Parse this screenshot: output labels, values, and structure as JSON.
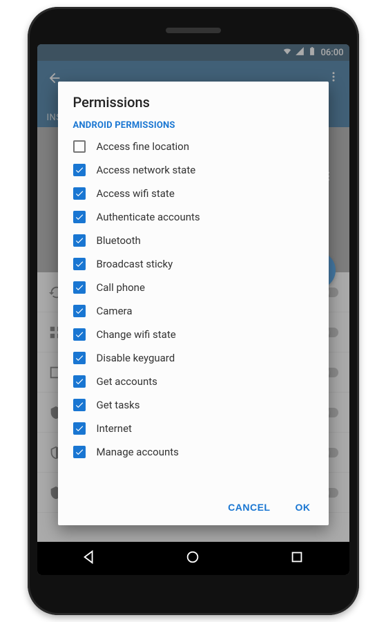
{
  "status": {
    "time": "06:00"
  },
  "appbar": {
    "tab": "INSTA"
  },
  "dialog": {
    "title": "Permissions",
    "section": "ANDROID PERMISSIONS",
    "items": [
      {
        "label": "Access fine location",
        "checked": false
      },
      {
        "label": "Access network state",
        "checked": true
      },
      {
        "label": "Access wifi state",
        "checked": true
      },
      {
        "label": "Authenticate accounts",
        "checked": true
      },
      {
        "label": "Bluetooth",
        "checked": true
      },
      {
        "label": "Broadcast sticky",
        "checked": true
      },
      {
        "label": "Call phone",
        "checked": true
      },
      {
        "label": "Camera",
        "checked": true
      },
      {
        "label": "Change wifi state",
        "checked": true
      },
      {
        "label": "Disable keyguard",
        "checked": true
      },
      {
        "label": "Get accounts",
        "checked": true
      },
      {
        "label": "Get tasks",
        "checked": true
      },
      {
        "label": "Internet",
        "checked": true
      },
      {
        "label": "Manage accounts",
        "checked": true
      }
    ],
    "cancel": "CANCEL",
    "ok": "OK"
  }
}
